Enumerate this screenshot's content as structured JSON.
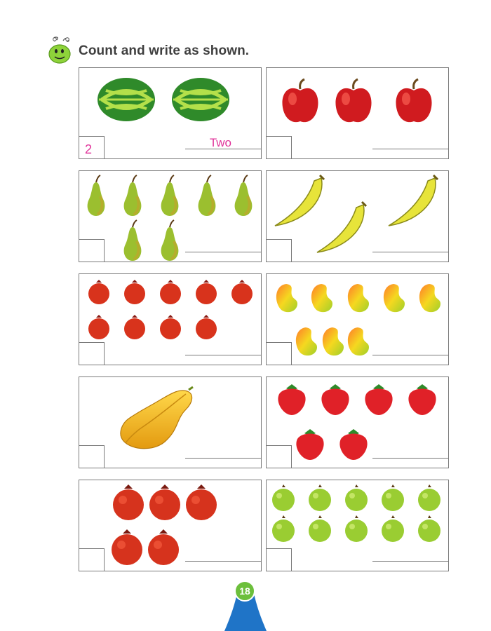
{
  "page": {
    "instruction": "Count and write as shown.",
    "page_number": "18",
    "mascot_icon": "smiling-caterpillar-icon",
    "accent_color": "#e0339a",
    "page_badge_color": "#6cbf3b",
    "footer_color": "#1f74c7"
  },
  "exercises": [
    {
      "fruit": "watermelon",
      "count": 2,
      "answer_number": "2",
      "answer_word": "Two"
    },
    {
      "fruit": "apple",
      "count": 3,
      "answer_number": "",
      "answer_word": ""
    },
    {
      "fruit": "pear",
      "count": 7,
      "answer_number": "",
      "answer_word": ""
    },
    {
      "fruit": "banana",
      "count": 3,
      "answer_number": "",
      "answer_word": ""
    },
    {
      "fruit": "pomegranate-small",
      "count": 9,
      "answer_number": "",
      "answer_word": ""
    },
    {
      "fruit": "mango",
      "count": 8,
      "answer_number": "",
      "answer_word": ""
    },
    {
      "fruit": "papaya",
      "count": 1,
      "answer_number": "",
      "answer_word": ""
    },
    {
      "fruit": "strawberry",
      "count": 6,
      "answer_number": "",
      "answer_word": ""
    },
    {
      "fruit": "pomegranate",
      "count": 5,
      "answer_number": "",
      "answer_word": ""
    },
    {
      "fruit": "guava",
      "count": 10,
      "answer_number": "",
      "answer_word": ""
    }
  ]
}
